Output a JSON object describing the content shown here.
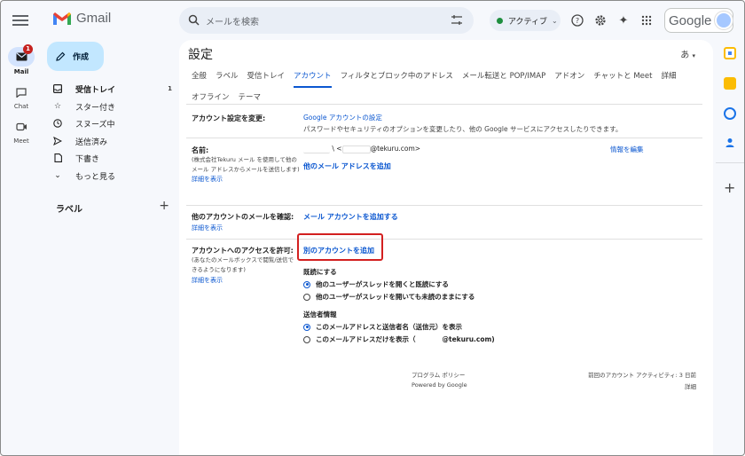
{
  "header": {
    "app_name": "Gmail",
    "search_placeholder": "メールを検索",
    "status": "アクティブ",
    "brand": "Google"
  },
  "rail": {
    "mail": "Mail",
    "mail_badge": "1",
    "chat": "Chat",
    "meet": "Meet"
  },
  "nav": {
    "compose": "作成",
    "items": [
      {
        "label": "受信トレイ",
        "count": "1"
      },
      {
        "label": "スター付き"
      },
      {
        "label": "スヌーズ中"
      },
      {
        "label": "送信済み"
      },
      {
        "label": "下書き"
      },
      {
        "label": "もっと見る"
      }
    ],
    "labels_heading": "ラベル"
  },
  "settings": {
    "title": "設定",
    "lang_icon": "あ",
    "tabs_row1": [
      "全般",
      "ラベル",
      "受信トレイ",
      "アカウント",
      "フィルタとブロック中のアドレス",
      "メール転送と POP/IMAP",
      "アドオン",
      "チャットと Meet",
      "詳細"
    ],
    "tabs_row2": [
      "オフライン",
      "テーマ"
    ],
    "account_change": {
      "label": "アカウント設定を変更:",
      "link": "Google アカウントの設定",
      "desc": "パスワードやセキュリティのオプションを変更したり、他の Google サービスにアクセスしたりできます。"
    },
    "name": {
      "label": "名前:",
      "note": "(株式会社Tekuru メール を使用して他のメール アドレスからメールを送信します)",
      "details": "詳細を表示",
      "address_suffix": "@tekuru.com>",
      "add_other": "他のメール アドレスを追加",
      "edit": "情報を編集"
    },
    "check_mail": {
      "label": "他のアカウントのメールを確認:",
      "details": "詳細を表示",
      "add": "メール アカウントを追加する"
    },
    "grant_access": {
      "label": "アカウントへのアクセスを許可:",
      "note": "(あなたのメールボックスで閲覧/送信できるようになります)",
      "details": "詳細を表示",
      "add": "別のアカウントを追加",
      "read_heading": "既読にする",
      "read_options": [
        "他のユーザーがスレッドを開くと既読にする",
        "他のユーザーがスレッドを開いても未読のままにする"
      ],
      "sender_heading": "送信者情報",
      "sender_options": [
        "このメールアドレスと送信者名（送信元）を表示",
        "このメールアドレスだけを表示（"
      ],
      "sender_suffix": "@tekuru.com)"
    },
    "footer": {
      "policy": "プログラム ポリシー",
      "powered": "Powered by Google",
      "activity": "前回のアカウント アクティビティ: 3 日前",
      "details": "詳細"
    }
  }
}
